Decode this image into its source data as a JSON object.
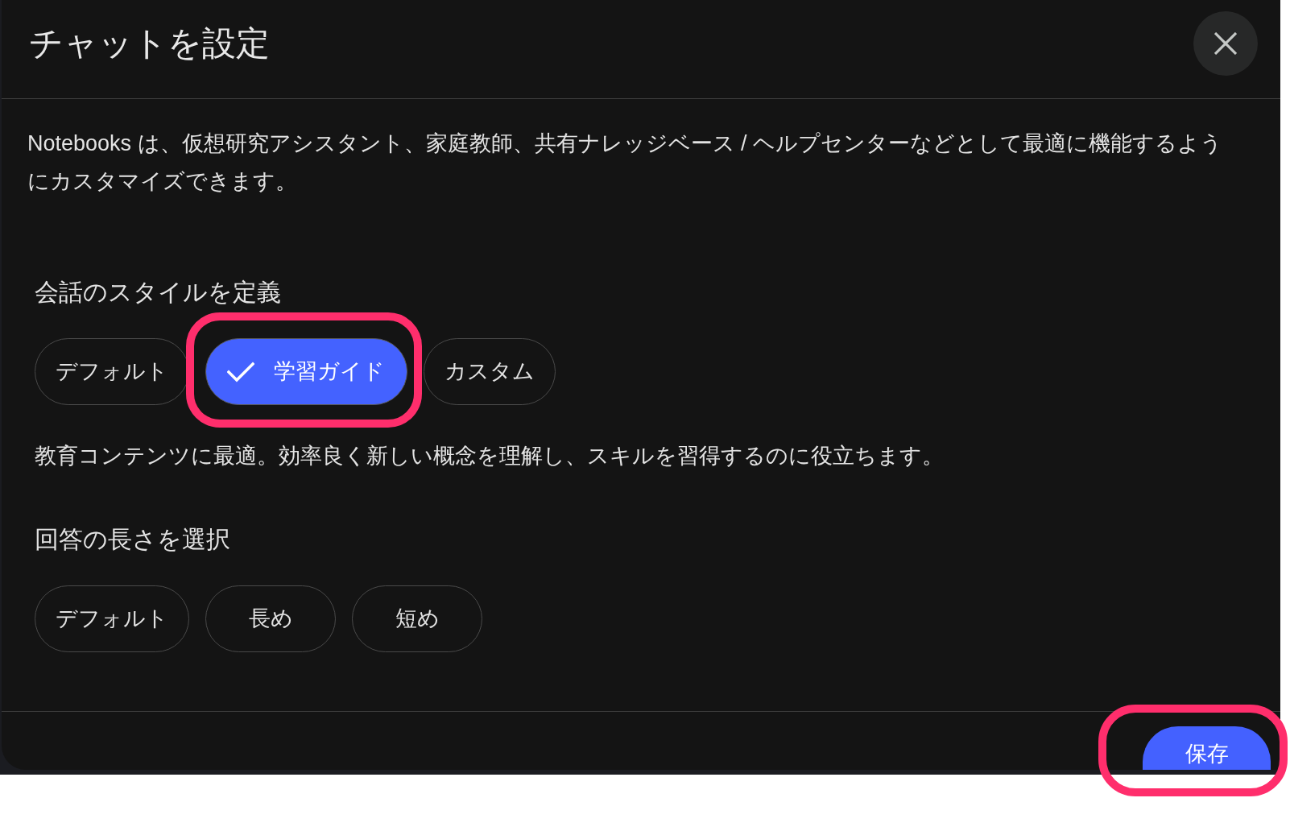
{
  "dialog": {
    "title": "チャットを設定",
    "description": "Notebooks は、仮想研究アシスタント、家庭教師、共有ナレッジベース / ヘルプセンターなどとして最適に機能するようにカスタマイズできます。"
  },
  "sections": [
    {
      "heading": "会話のスタイルを定義",
      "options": [
        {
          "label": "デフォルト",
          "selected": false,
          "highlighted": false
        },
        {
          "label": "学習ガイド",
          "selected": true,
          "highlighted": true
        },
        {
          "label": "カスタム",
          "selected": false,
          "highlighted": false
        }
      ],
      "hint": "教育コンテンツに最適。効率良く新しい概念を理解し、スキルを習得するのに役立ちます。"
    },
    {
      "heading": "回答の長さを選択",
      "options": [
        {
          "label": "デフォルト",
          "selected": false,
          "highlighted": false
        },
        {
          "label": "長め",
          "selected": false,
          "highlighted": false
        },
        {
          "label": "短め",
          "selected": false,
          "highlighted": false
        }
      ]
    }
  ],
  "footer": {
    "save_button": {
      "label": "保存",
      "highlighted": true
    }
  }
}
